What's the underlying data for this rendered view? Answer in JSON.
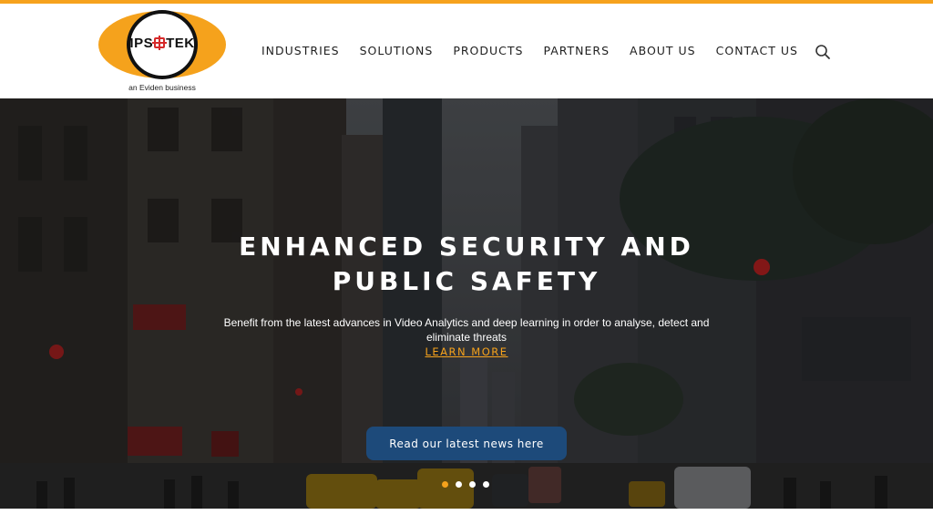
{
  "brand": {
    "logo_text_left": "IPS",
    "logo_text_right": "TEK",
    "tagline": "an Eviden business",
    "accent_color": "#f5a21c",
    "cross_color": "#d62a2a"
  },
  "nav": {
    "items": [
      {
        "label": "INDUSTRIES"
      },
      {
        "label": "SOLUTIONS"
      },
      {
        "label": "PRODUCTS"
      },
      {
        "label": "PARTNERS"
      },
      {
        "label": "ABOUT US"
      },
      {
        "label": "CONTACT US"
      }
    ],
    "search_icon": "search-icon"
  },
  "hero": {
    "title_line1": "ENHANCED SECURITY AND",
    "title_line2": "PUBLIC SAFETY",
    "description": "Benefit from the latest advances in Video Analytics and deep learning in order to analyse, detect and eliminate threats",
    "learn_more": "LEARN MORE",
    "news_button": "Read our latest news here",
    "button_color": "#1d4a7a",
    "slides": 4,
    "active_slide": 1
  }
}
